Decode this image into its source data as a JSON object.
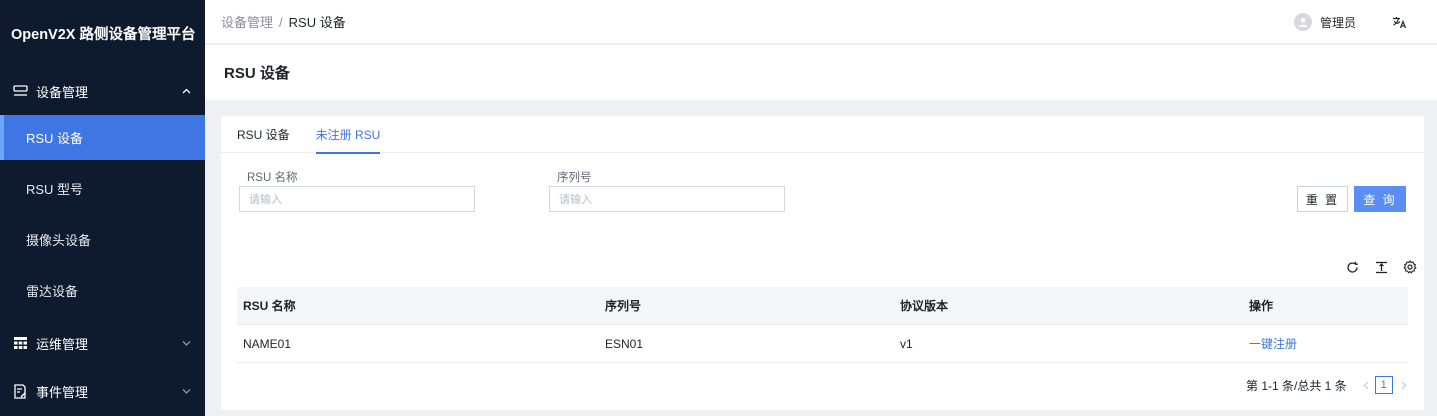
{
  "app": {
    "title": "OpenV2X 路侧设备管理平台"
  },
  "sidebar": {
    "groups": [
      {
        "label": "设备管理",
        "icon": "server-icon",
        "expanded": true,
        "items": [
          {
            "label": "RSU 设备",
            "active": true
          },
          {
            "label": "RSU 型号"
          },
          {
            "label": "摄像头设备"
          },
          {
            "label": "雷达设备"
          }
        ]
      },
      {
        "label": "运维管理",
        "icon": "ops-grid-icon",
        "expanded": false
      },
      {
        "label": "事件管理",
        "icon": "event-doc-icon",
        "expanded": false
      }
    ]
  },
  "header": {
    "breadcrumb": [
      "设备管理",
      "/",
      "RSU 设备"
    ],
    "user": "管理员",
    "lang_icon": "translate-icon"
  },
  "page": {
    "title": "RSU 设备"
  },
  "tabs": [
    {
      "label": "RSU 设备",
      "active": false
    },
    {
      "label": "未注册 RSU",
      "active": true
    }
  ],
  "filters": {
    "name": {
      "label": "RSU 名称",
      "placeholder": "请输入"
    },
    "serial": {
      "label": "序列号",
      "placeholder": "请输入"
    },
    "reset_label": "重 置",
    "query_label": "查 询"
  },
  "table": {
    "columns": [
      "RSU 名称",
      "序列号",
      "协议版本",
      "操作"
    ],
    "rows": [
      {
        "name": "NAME01",
        "serial": "ESN01",
        "protocol": "v1",
        "action": "一键注册"
      }
    ]
  },
  "pagination": {
    "summary": "第 1-1 条/总共 1 条",
    "current_page": "1"
  },
  "colors": {
    "sidebar_bg": "#0e1a2e",
    "accent": "#3f76e4",
    "primary_button": "#5a8ef2"
  }
}
